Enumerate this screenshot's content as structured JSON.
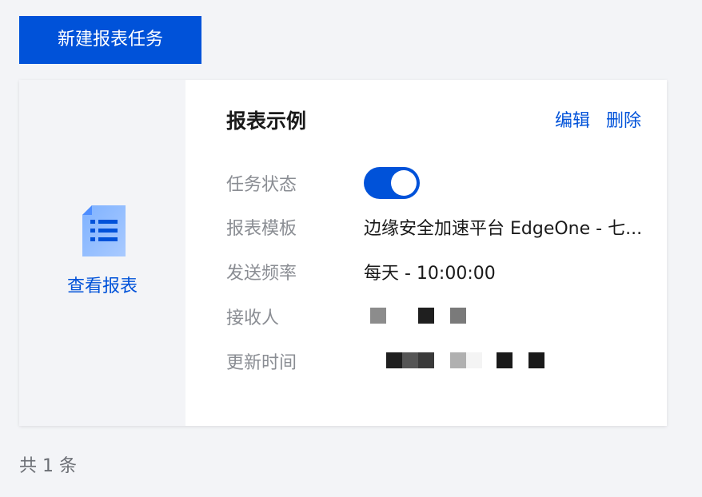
{
  "toolbar": {
    "new_task_label": "新建报表任务"
  },
  "card": {
    "view_report_label": "查看报表",
    "doc_icon": "document-list-icon",
    "title": "报表示例",
    "actions": {
      "edit_label": "编辑",
      "delete_label": "删除"
    },
    "fields": {
      "status_label": "任务状态",
      "status_enabled": true,
      "template_label": "报表模板",
      "template_value": "边缘安全加速平台 EdgeOne - 七...",
      "frequency_label": "发送频率",
      "frequency_value": "每天 - 10:00:00",
      "recipients_label": "接收人",
      "updated_label": "更新时间"
    }
  },
  "footer": {
    "total_label": "共 1 条"
  },
  "colors": {
    "accent": "#0052d9",
    "background": "#f3f4f7",
    "label_gray": "#8a8d93"
  }
}
